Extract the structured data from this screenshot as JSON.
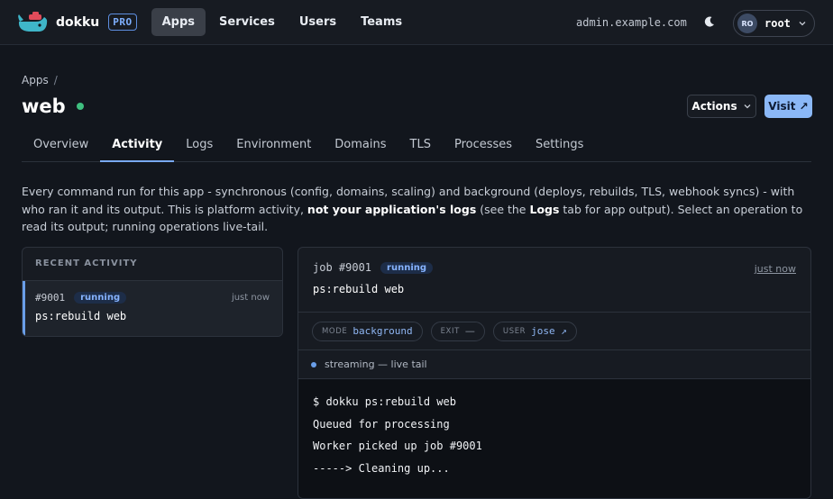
{
  "topbar": {
    "brand": "dokku",
    "badge": "PRO",
    "nav": [
      "Apps",
      "Services",
      "Users",
      "Teams"
    ],
    "active_nav": "Apps",
    "host": "admin.example.com",
    "user": {
      "initials": "RO",
      "name": "root"
    }
  },
  "header": {
    "breadcrumb": "Apps",
    "breadcrumb_sep": "/",
    "title": "web",
    "status_color": "#3fbf7f",
    "actions_label": "Actions",
    "visit_label": "Visit ↗"
  },
  "tabs": [
    "Overview",
    "Activity",
    "Logs",
    "Environment",
    "Domains",
    "TLS",
    "Processes",
    "Settings"
  ],
  "active_tab": "Activity",
  "description": {
    "part1": "Every command run for this app - synchronous (config, domains, scaling) and background (deploys, rebuilds, TLS, webhook syncs) - with who ran it and its output. This is platform activity, ",
    "bold1": "not your application's logs",
    "part2": " (see the ",
    "bold2": "Logs",
    "part3": " tab for app output). Select an operation to read its output; running operations live-tail."
  },
  "recent": {
    "heading": "RECENT ACTIVITY",
    "items": [
      {
        "id": "#9001",
        "status": "running",
        "time": "just now",
        "command": "ps:rebuild web"
      }
    ]
  },
  "job": {
    "title": "job #9001",
    "status": "running",
    "time": "just now",
    "command": "ps:rebuild web",
    "chips": {
      "mode_key": "MODE",
      "mode_val": "background",
      "exit_key": "EXIT",
      "exit_val": "—",
      "user_key": "USER",
      "user_val": "jose ↗"
    },
    "stream_label": "streaming — live tail",
    "output": [
      "$ dokku ps:rebuild web",
      "Queued for processing",
      "Worker picked up job #9001",
      "-----> Cleaning up..."
    ]
  },
  "colors": {
    "accent": "#79a9f0",
    "running_badge": "#86b3ff",
    "visit_button": "#8bb8f7"
  }
}
